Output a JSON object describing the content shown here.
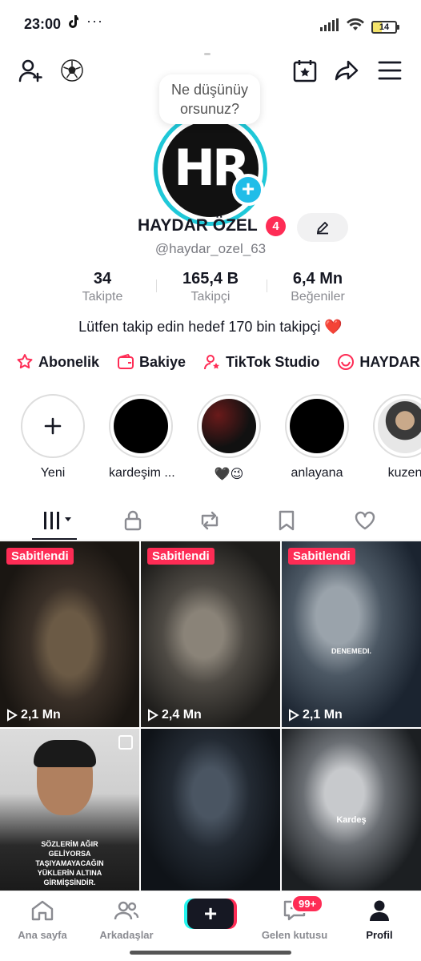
{
  "status_bar": {
    "time": "23:00",
    "dots": "···",
    "battery": "14"
  },
  "thought_bubble": {
    "line1": "Ne düşünüy",
    "line2": "orsunuz?"
  },
  "avatar": {
    "text": "HR"
  },
  "profile": {
    "name": "HAYDAR ÖZEL",
    "badge": "4",
    "handle": "@haydar_ozel_63",
    "bio": "Lütfen takip edin hedef 170 bin takipçi ❤️"
  },
  "stats": [
    {
      "value": "34",
      "label": "Takipte"
    },
    {
      "value": "165,4 B",
      "label": "Takipçi"
    },
    {
      "value": "6,4 Mn",
      "label": "Beğeniler"
    }
  ],
  "quick_links": [
    {
      "label": "Abonelik",
      "icon": "star-badge-icon"
    },
    {
      "label": "Bakiye",
      "icon": "wallet-icon"
    },
    {
      "label": "TikTok Studio",
      "icon": "person-star-icon"
    },
    {
      "label": "HAYDAR",
      "icon": "smile-icon"
    }
  ],
  "stories": [
    {
      "label": "Yeni"
    },
    {
      "label": "kardeşim ..."
    },
    {
      "label": "🖤😉"
    },
    {
      "label": "anlayana"
    },
    {
      "label": "kuzen"
    }
  ],
  "grid": {
    "pinned_label": "Sabitlendi",
    "items": [
      {
        "views": "2,1 Mn",
        "caption": ""
      },
      {
        "views": "2,4 Mn",
        "caption": ""
      },
      {
        "views": "2,1 Mn",
        "caption": "DENEMEDI."
      },
      {
        "views": "",
        "caption": "SÖZLERİM AĞIR GELİYORSA TAŞIYAMAYACAĞIN YÜKLERİN ALTINA GİRMİŞSİNDİR."
      },
      {
        "views": "",
        "caption": ""
      },
      {
        "views": "",
        "caption": "Kardeş"
      }
    ]
  },
  "bottom_nav": {
    "home": "Ana sayfa",
    "friends": "Arkadaşlar",
    "create": "+",
    "inbox": "Gelen kutusu",
    "inbox_badge": "99+",
    "profile": "Profil"
  },
  "colors": {
    "accent": "#fe2c55",
    "ring": "#1fc8d8",
    "cyan": "#25f4ee"
  }
}
